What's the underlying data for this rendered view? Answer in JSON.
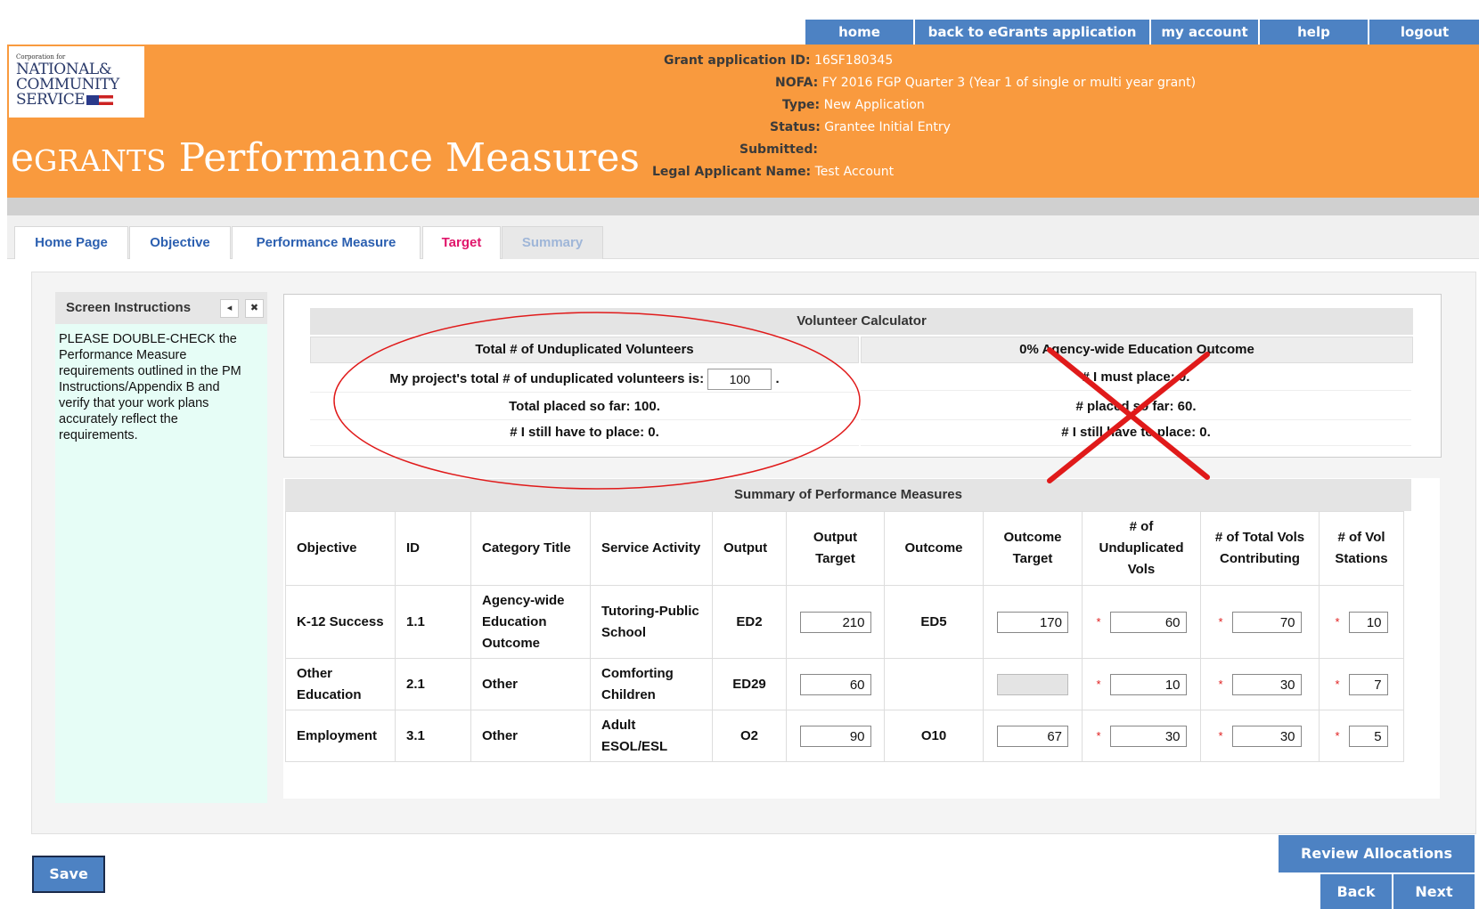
{
  "nav": {
    "items": [
      "home",
      "back to eGrants application",
      "my account",
      "help",
      "logout"
    ]
  },
  "logo": {
    "small": "Corporation for",
    "line1": "NATIONAL&",
    "line2": "COMMUNITY",
    "line3": "SERVICE"
  },
  "app_title": {
    "first": "e",
    "smallcaps": "GRANTS",
    "rest": " Performance Measures"
  },
  "grant": {
    "application_id_label": "Grant application ID:",
    "application_id": "16SF180345",
    "nofa_label": "NOFA:",
    "nofa": "FY 2016 FGP Quarter 3 (Year 1 of single or multi year grant)",
    "type_label": "Type:",
    "type": "New Application",
    "status_label": "Status:",
    "status": "Grantee Initial Entry",
    "submitted_label": "Submitted:",
    "submitted": "",
    "applicant_label": "Legal Applicant Name:",
    "applicant": "Test Account"
  },
  "tabs": [
    "Home Page",
    "Objective",
    "Performance Measure",
    "Target",
    "Summary"
  ],
  "instructions": {
    "title": "Screen Instructions",
    "collapse_glyph": "◂",
    "close_glyph": "✖",
    "text": "PLEASE DOUBLE-CHECK the Performance Measure requirements outlined in the PM Instructions/Appendix B and verify that your work plans accurately reflect the requirements."
  },
  "calculator": {
    "title": "Volunteer Calculator",
    "left": {
      "header": "Total # of Unduplicated Volunteers",
      "line1_label": "My project's total # of unduplicated volunteers is:",
      "line1_value": "100",
      "line1_suffix": ".",
      "line2": "Total placed so far: 100.",
      "line3": "# I still have to place: 0."
    },
    "right": {
      "header": "0% Agency-wide Education Outcome",
      "line1": "# I must place: 0.",
      "line2": "# placed so far: 60.",
      "line3": "# I still have to place: 0."
    }
  },
  "summary": {
    "title": "Summary of Performance Measures",
    "columns": [
      "Objective",
      "ID",
      "Category Title",
      "Service Activity",
      "Output",
      "Output Target",
      "Outcome",
      "Outcome Target",
      "# of Unduplicated Vols",
      "# of Total Vols Contributing",
      "# of Vol Stations"
    ],
    "required_mark": "*",
    "rows": [
      {
        "objective": "K-12 Success",
        "id": "1.1",
        "category": "Agency-wide Education Outcome",
        "activity": "Tutoring-Public School",
        "output": "ED2",
        "output_target": "210",
        "outcome": "ED5",
        "outcome_target": "170",
        "unduplicated": "60",
        "total_vols": "70",
        "stations": "10"
      },
      {
        "objective": "Other Education",
        "id": "2.1",
        "category": "Other",
        "activity": "Comforting Children",
        "output": "ED29",
        "output_target": "60",
        "outcome": "",
        "outcome_target": "",
        "unduplicated": "10",
        "total_vols": "30",
        "stations": "7"
      },
      {
        "objective": "Employment",
        "id": "3.1",
        "category": "Other",
        "activity": "Adult ESOL/ESL",
        "output": "O2",
        "output_target": "90",
        "outcome": "O10",
        "outcome_target": "67",
        "unduplicated": "30",
        "total_vols": "30",
        "stations": "5"
      }
    ]
  },
  "buttons": {
    "save": "Save",
    "review": "Review Allocations",
    "back": "Back",
    "next": "Next"
  },
  "colors": {
    "nav_blue": "#4d82c3",
    "header_orange": "#f99a3e",
    "annotation_red": "#e01a1a",
    "active_tab": "#e0156a",
    "panel_mint": "#e6fdf6"
  }
}
